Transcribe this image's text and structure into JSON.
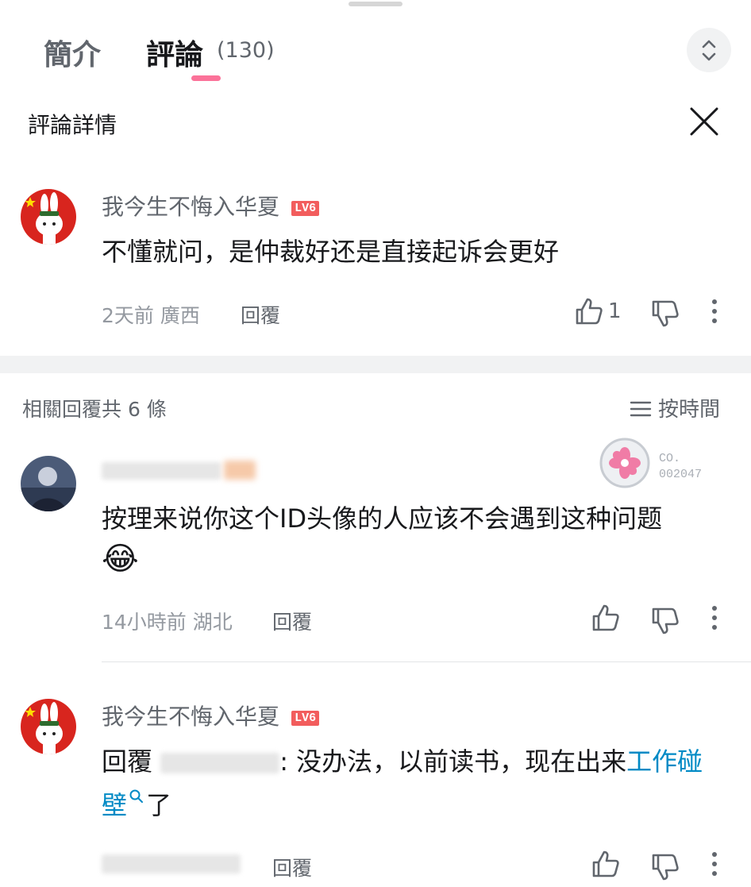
{
  "tabs": {
    "intro_label": "簡介",
    "comments_label": "評論",
    "comments_count": "(130)"
  },
  "panel": {
    "title": "評論詳情"
  },
  "main_comment": {
    "username": "我今生不悔入华夏",
    "level": "LV6",
    "text": "不懂就问，是仲裁好还是直接起诉会更好",
    "time_location": "2天前 廣西",
    "reply_label": "回覆",
    "likes": "1"
  },
  "replies_header": {
    "title": "相關回覆共 6 條",
    "sort_label": "按時間"
  },
  "replies": [
    {
      "text": "按理来说你这个ID头像的人应该不会遇到这种问题",
      "emoji": "😂",
      "time_location": "14小時前 湖北",
      "reply_label": "回覆",
      "badge_title": "CO.",
      "badge_number": "002047"
    },
    {
      "username": "我今生不悔入华夏",
      "level": "LV6",
      "text_prefix": "回覆 ",
      "text_mid": ": 没办法，以前读书，现在出来",
      "link_text": "工作碰壁",
      "text_suffix": "了",
      "reply_label": "回覆"
    }
  ],
  "colors": {
    "accent_pink": "#fb7299",
    "level_red": "#f25d5d",
    "link_blue": "#008ac5"
  }
}
